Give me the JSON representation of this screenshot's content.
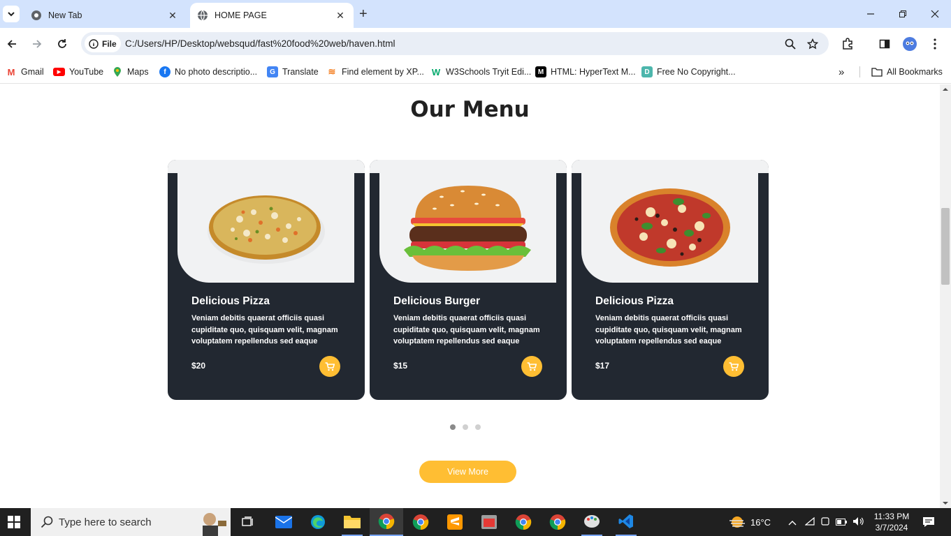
{
  "browser": {
    "tabs": [
      {
        "title": "New Tab"
      },
      {
        "title": "HOME PAGE"
      }
    ],
    "address": {
      "chip_label": "File",
      "url": "C:/Users/HP/Desktop/websqud/fast%20food%20web/haven.html"
    },
    "bookmarks": [
      {
        "label": "Gmail",
        "icon": "gmail-icon",
        "color": "#ea4335"
      },
      {
        "label": "YouTube",
        "icon": "youtube-icon",
        "color": "#ff0000"
      },
      {
        "label": "Maps",
        "icon": "maps-icon",
        "color": "#34a853"
      },
      {
        "label": "No photo descriptio...",
        "icon": "facebook-icon",
        "color": "#1877f2"
      },
      {
        "label": "Translate",
        "icon": "translate-icon",
        "color": "#4285f4"
      },
      {
        "label": "Find element by XP...",
        "icon": "stackoverflow-icon",
        "color": "#f48024"
      },
      {
        "label": "W3Schools Tryit Edi...",
        "icon": "w3schools-icon",
        "color": "#04aa6d"
      },
      {
        "label": "HTML: HyperText M...",
        "icon": "mdn-icon",
        "color": "#000000"
      },
      {
        "label": "Free No Copyright...",
        "icon": "doc-icon",
        "color": "#4db6ac"
      }
    ],
    "all_bookmarks": "All Bookmarks"
  },
  "page": {
    "heading": "Our Menu",
    "cards": [
      {
        "name": "Delicious Pizza",
        "description": "Veniam debitis quaerat officiis quasi cupiditate quo, quisquam velit, magnam voluptatem repellendus sed eaque",
        "price": "$20",
        "image": "pizza-image"
      },
      {
        "name": "Delicious Burger",
        "description": "Veniam debitis quaerat officiis quasi cupiditate quo, quisquam velit, magnam voluptatem repellendus sed eaque",
        "price": "$15",
        "image": "burger-image"
      },
      {
        "name": "Delicious Pizza",
        "description": "Veniam debitis quaerat officiis quasi cupiditate quo, quisquam velit, magnam voluptatem repellendus sed eaque",
        "price": "$17",
        "image": "pizza-image"
      }
    ],
    "carousel_pages": 3,
    "carousel_active": 1,
    "view_more": "View More",
    "accent_color": "#ffbe33",
    "card_color": "#222831"
  },
  "taskbar": {
    "search_placeholder": "Type here to search",
    "weather": "16°C",
    "time": "11:33 PM",
    "date": "3/7/2024"
  }
}
